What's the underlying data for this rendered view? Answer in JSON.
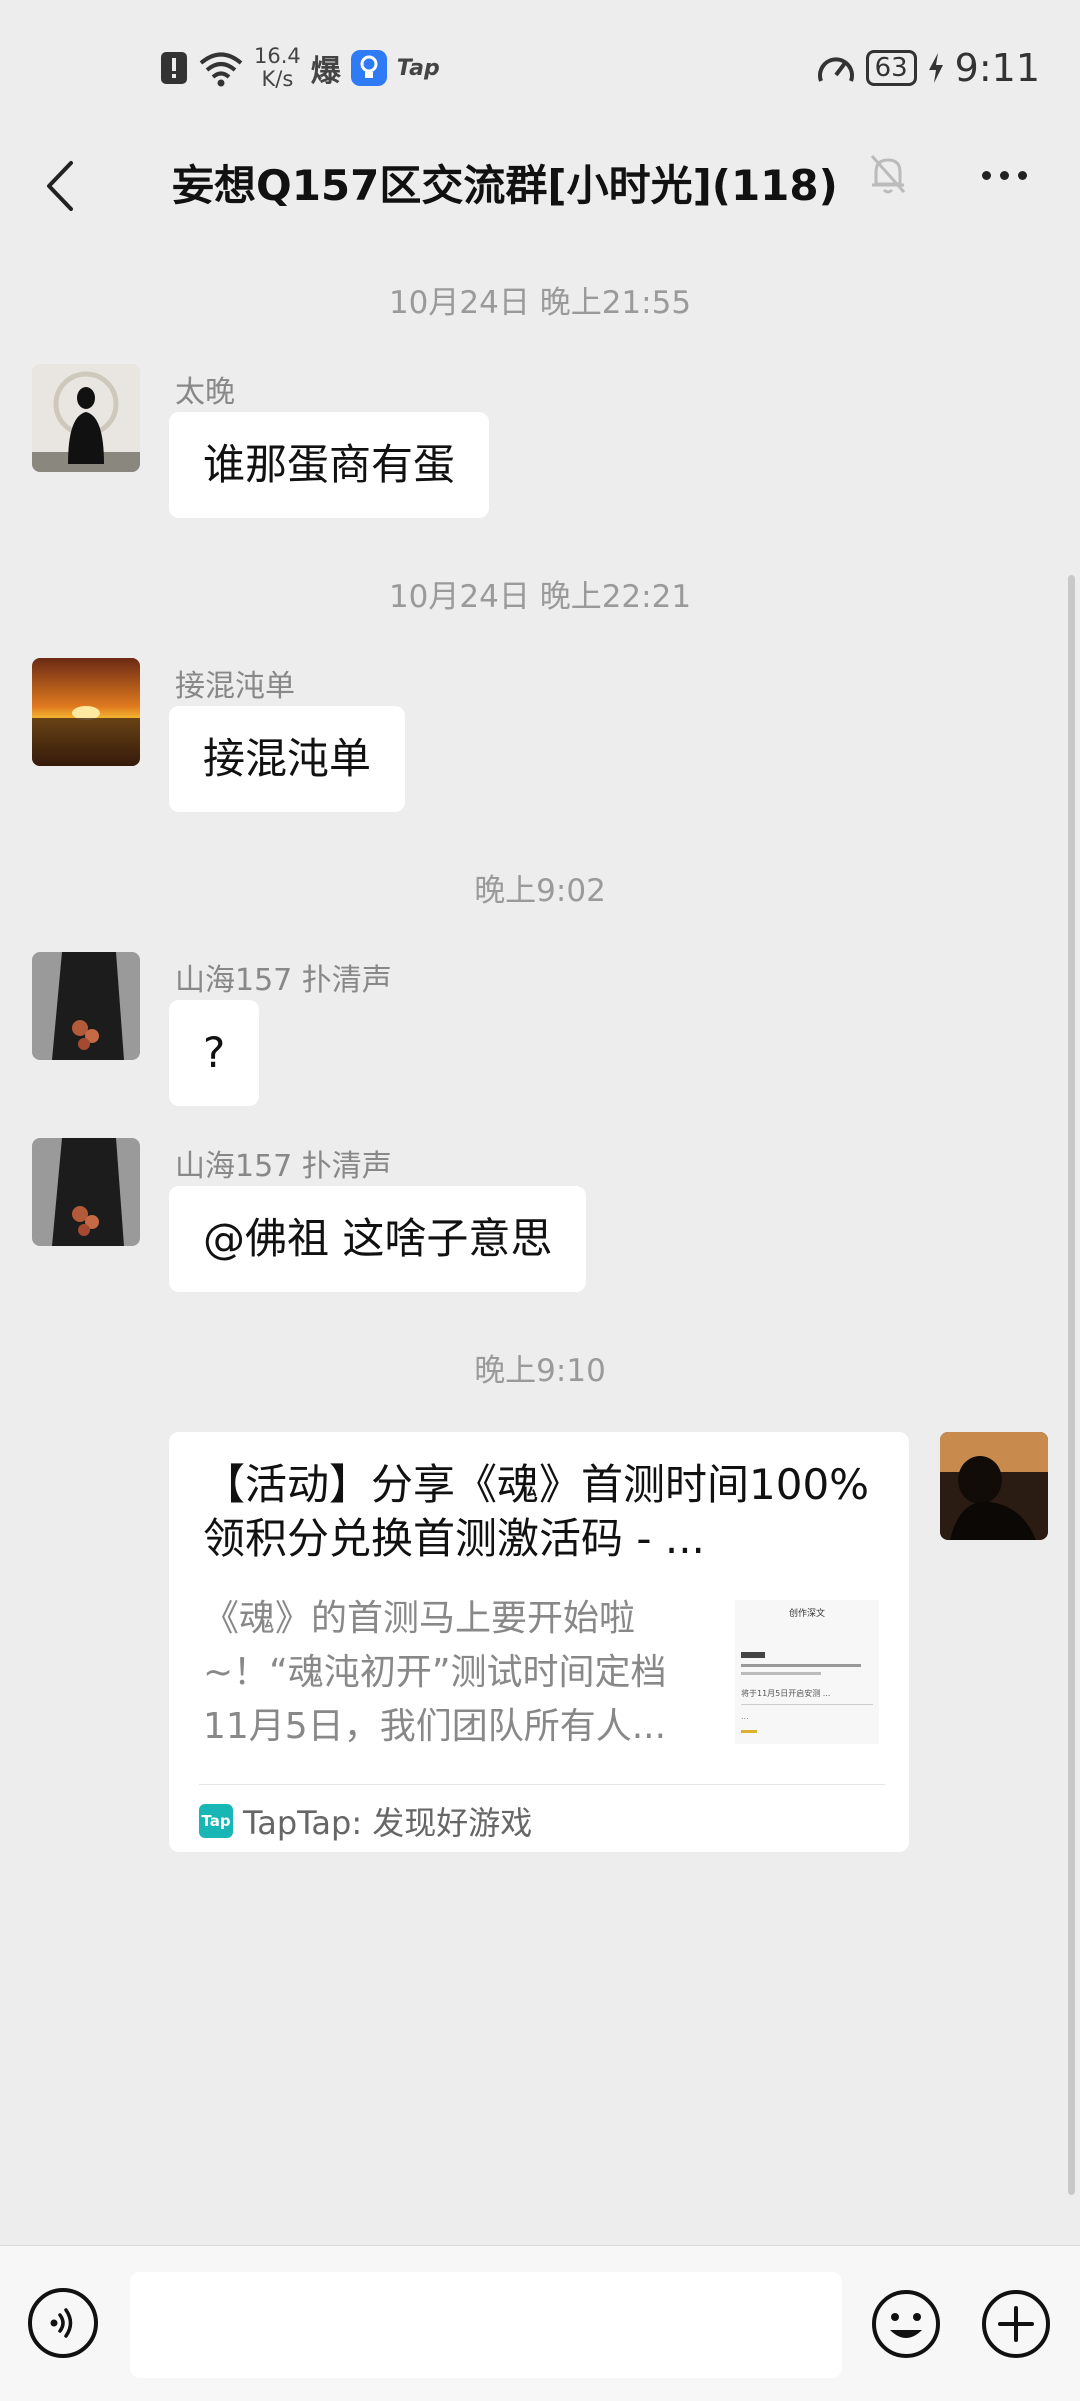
{
  "status_bar": {
    "net_speed_value": "16.4",
    "net_speed_unit": "K/s",
    "app_label_1": "爆",
    "app_label_2": "Tap",
    "battery": "63",
    "time": "9:11"
  },
  "header": {
    "title": "妄想Q157区交流群[小时光](118)"
  },
  "messages": [
    {
      "timestamp": "10月24日 晚上21:55",
      "sender": "太晚",
      "text": "谁那蛋商有蛋"
    },
    {
      "timestamp": "10月24日 晚上22:21",
      "sender": "接混沌单",
      "text": "接混沌单"
    },
    {
      "timestamp": "晚上9:02",
      "sender": "山海157 扑清声",
      "text": "?"
    },
    {
      "sender": "山海157 扑清声",
      "text": "@佛祖  这啥子意思"
    }
  ],
  "card_timestamp": "晚上9:10",
  "link_card": {
    "title": "【活动】分享《魂》首测时间100%领积分兑换首测激活码 - ...",
    "description": "《魂》的首测马上要开始啦~！“魂沌初开”测试时间定档11月5日，我们团队所有人...",
    "source": "TapTap: 发现好游戏",
    "logo_text": "Tap",
    "thumb_header": "创作深文",
    "thumb_line": "将于11月5日开启安测 ...",
    "thumb_footer": "..."
  },
  "input_bar": {
    "placeholder": ""
  },
  "colors": {
    "background": "#ededed",
    "bubble": "#ffffff",
    "taptap_brand": "#19b6b6"
  }
}
